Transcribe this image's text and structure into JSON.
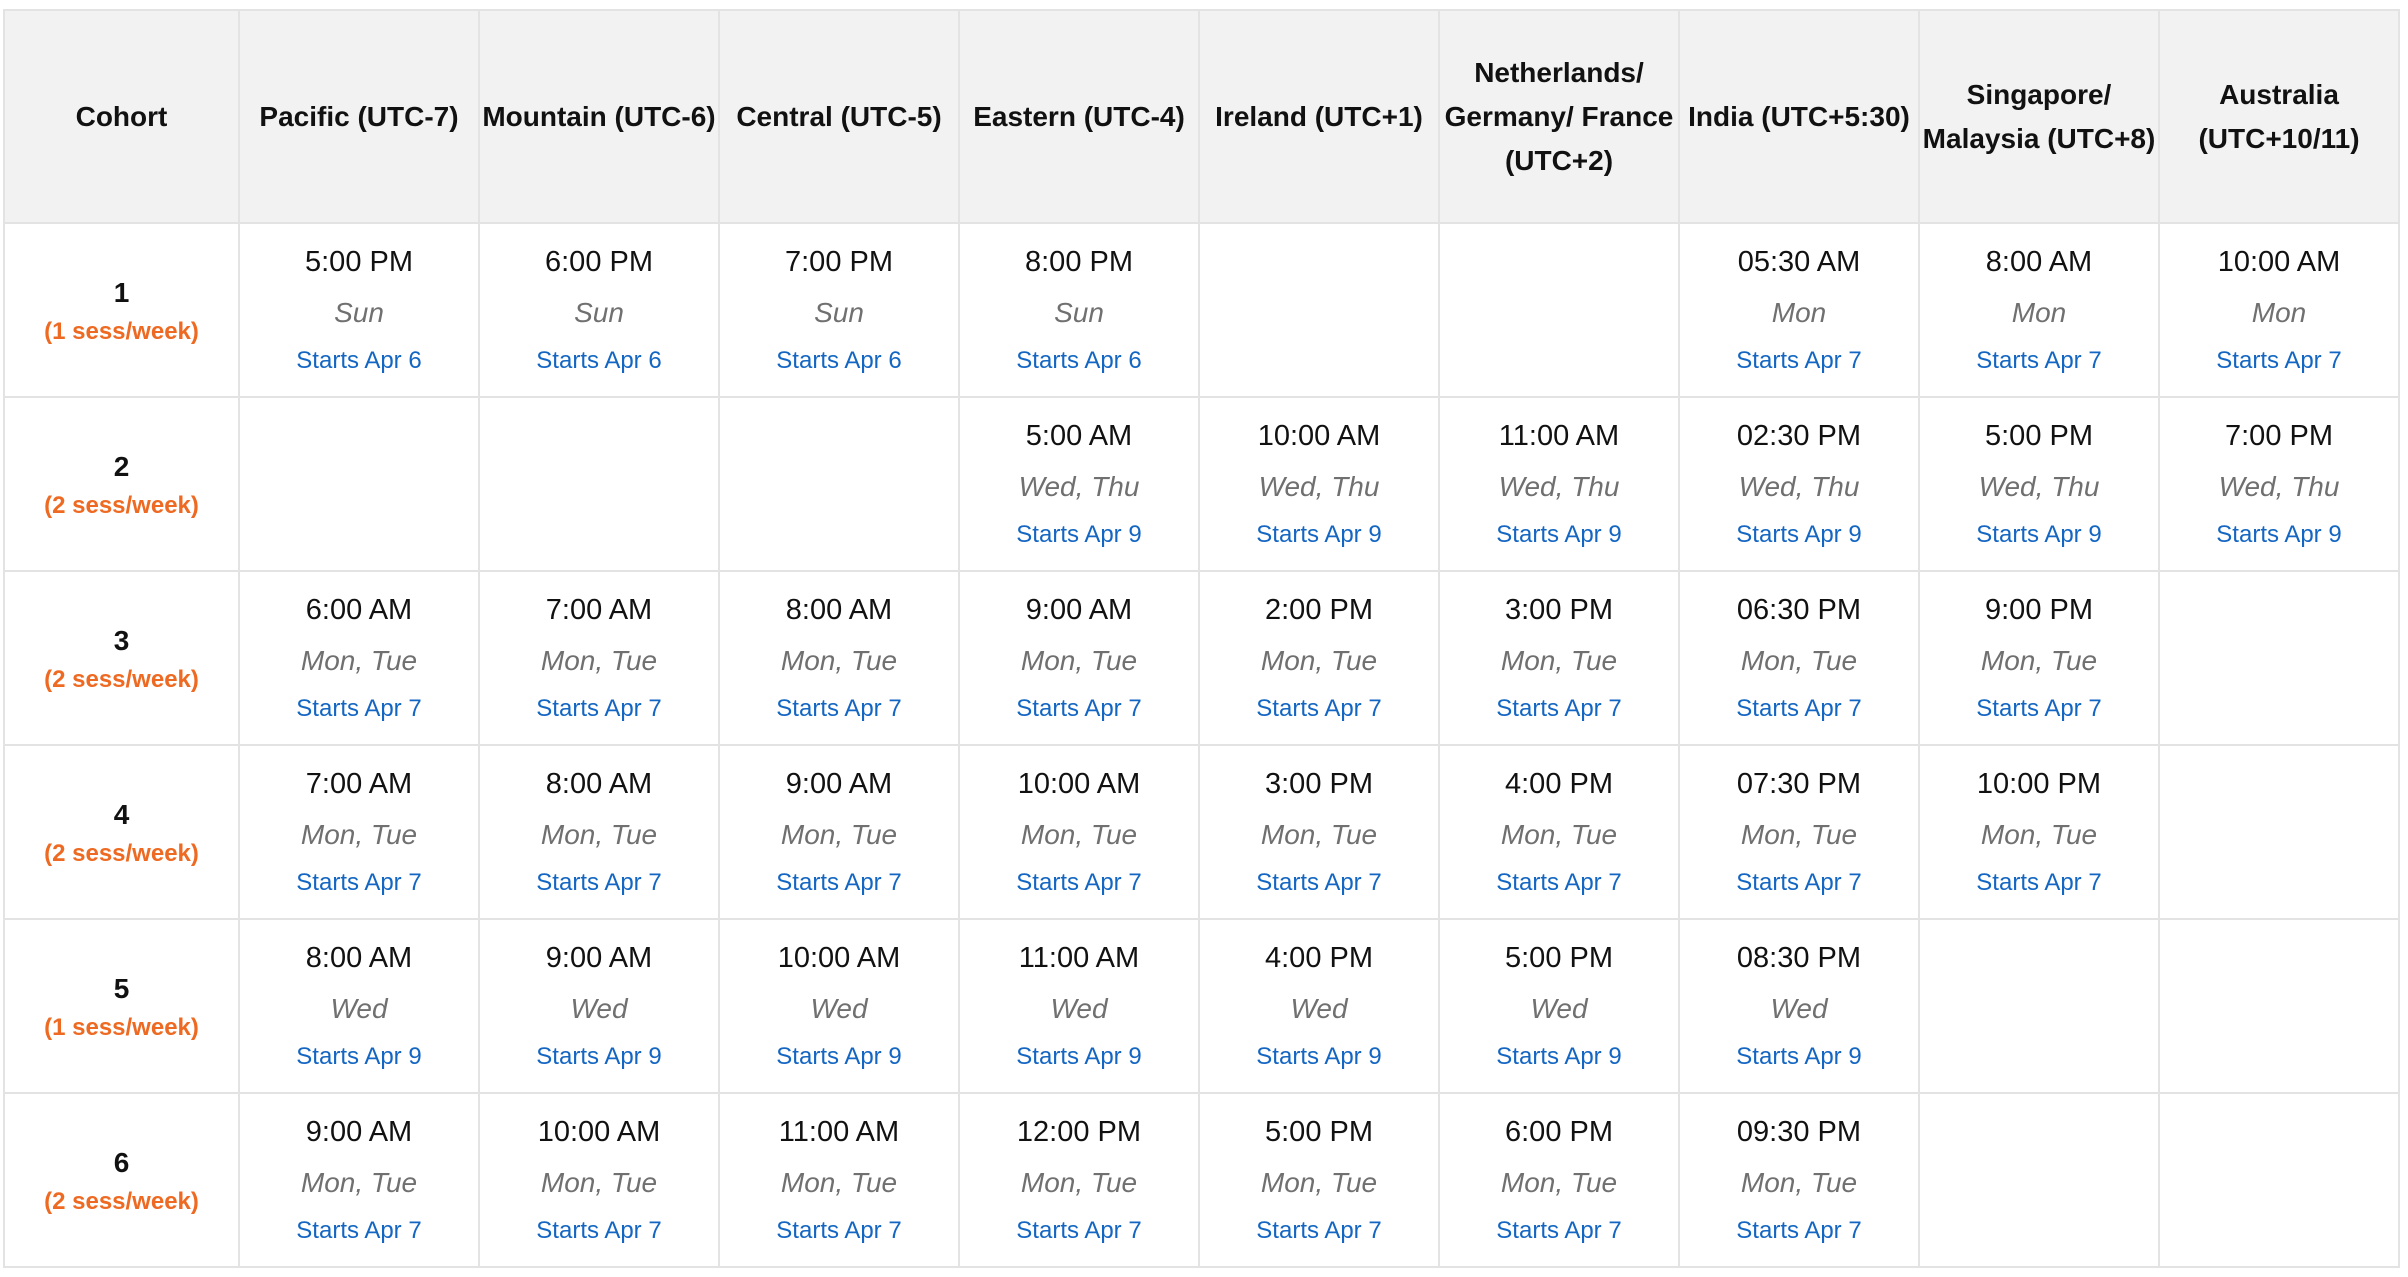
{
  "headers": [
    "Cohort",
    "Pacific (UTC-7)",
    "Mountain (UTC-6)",
    "Central (UTC-5)",
    "Eastern (UTC-4)",
    "Ireland (UTC+1)",
    "Netherlands/ Germany/ France (UTC+2)",
    "India (UTC+5:30)",
    "Singapore/ Malaysia (UTC+8)",
    "Australia (UTC+10/11)"
  ],
  "rows": [
    {
      "cohort": "1",
      "rate": "(1 sess/week)",
      "cells": [
        {
          "time": "5:00 PM",
          "days": "Sun",
          "start": "Starts Apr 6"
        },
        {
          "time": "6:00 PM",
          "days": "Sun",
          "start": "Starts Apr 6"
        },
        {
          "time": "7:00 PM",
          "days": "Sun",
          "start": "Starts Apr 6"
        },
        {
          "time": "8:00 PM",
          "days": "Sun",
          "start": "Starts Apr 6"
        },
        null,
        null,
        {
          "time": "05:30 AM",
          "days": "Mon",
          "start": "Starts Apr 7"
        },
        {
          "time": "8:00 AM",
          "days": "Mon",
          "start": "Starts Apr 7"
        },
        {
          "time": "10:00 AM",
          "days": "Mon",
          "start": "Starts Apr 7"
        }
      ]
    },
    {
      "cohort": "2",
      "rate": "(2 sess/week)",
      "cells": [
        null,
        null,
        null,
        {
          "time": "5:00 AM",
          "days": "Wed, Thu",
          "start": "Starts Apr 9"
        },
        {
          "time": "10:00 AM",
          "days": "Wed, Thu",
          "start": "Starts Apr 9"
        },
        {
          "time": "11:00 AM",
          "days": "Wed, Thu",
          "start": "Starts Apr 9"
        },
        {
          "time": "02:30 PM",
          "days": "Wed, Thu",
          "start": "Starts Apr 9"
        },
        {
          "time": "5:00 PM",
          "days": "Wed, Thu",
          "start": "Starts Apr 9"
        },
        {
          "time": "7:00 PM",
          "days": "Wed, Thu",
          "start": "Starts Apr 9"
        }
      ]
    },
    {
      "cohort": "3",
      "rate": "(2 sess/week)",
      "cells": [
        {
          "time": "6:00 AM",
          "days": "Mon, Tue",
          "start": "Starts Apr 7"
        },
        {
          "time": "7:00 AM",
          "days": "Mon, Tue",
          "start": "Starts Apr 7"
        },
        {
          "time": "8:00 AM",
          "days": "Mon, Tue",
          "start": "Starts Apr 7"
        },
        {
          "time": "9:00 AM",
          "days": "Mon, Tue",
          "start": "Starts Apr 7"
        },
        {
          "time": "2:00 PM",
          "days": "Mon, Tue",
          "start": "Starts Apr 7"
        },
        {
          "time": "3:00 PM",
          "days": "Mon, Tue",
          "start": "Starts Apr 7"
        },
        {
          "time": "06:30 PM",
          "days": "Mon, Tue",
          "start": "Starts Apr 7"
        },
        {
          "time": "9:00 PM",
          "days": "Mon, Tue",
          "start": "Starts Apr 7"
        },
        null
      ]
    },
    {
      "cohort": "4",
      "rate": "(2 sess/week)",
      "cells": [
        {
          "time": "7:00 AM",
          "days": "Mon, Tue",
          "start": "Starts Apr 7"
        },
        {
          "time": "8:00 AM",
          "days": "Mon, Tue",
          "start": "Starts Apr 7"
        },
        {
          "time": "9:00 AM",
          "days": "Mon, Tue",
          "start": "Starts Apr 7"
        },
        {
          "time": "10:00 AM",
          "days": "Mon, Tue",
          "start": "Starts Apr 7"
        },
        {
          "time": "3:00 PM",
          "days": "Mon, Tue",
          "start": "Starts Apr 7"
        },
        {
          "time": "4:00 PM",
          "days": "Mon, Tue",
          "start": "Starts Apr 7"
        },
        {
          "time": "07:30 PM",
          "days": "Mon, Tue",
          "start": "Starts Apr 7"
        },
        {
          "time": "10:00 PM",
          "days": "Mon, Tue",
          "start": "Starts Apr 7"
        },
        null
      ]
    },
    {
      "cohort": "5",
      "rate": "(1 sess/week)",
      "cells": [
        {
          "time": "8:00 AM",
          "days": "Wed",
          "start": "Starts Apr 9"
        },
        {
          "time": "9:00 AM",
          "days": "Wed",
          "start": "Starts Apr 9"
        },
        {
          "time": "10:00 AM",
          "days": "Wed",
          "start": "Starts Apr 9"
        },
        {
          "time": "11:00 AM",
          "days": "Wed",
          "start": "Starts Apr 9"
        },
        {
          "time": "4:00 PM",
          "days": "Wed",
          "start": "Starts Apr 9"
        },
        {
          "time": "5:00 PM",
          "days": "Wed",
          "start": "Starts Apr 9"
        },
        {
          "time": "08:30 PM",
          "days": "Wed",
          "start": "Starts Apr 9"
        },
        null,
        null
      ]
    },
    {
      "cohort": "6",
      "rate": "(2 sess/week)",
      "cells": [
        {
          "time": "9:00 AM",
          "days": "Mon, Tue",
          "start": "Starts Apr 7"
        },
        {
          "time": "10:00 AM",
          "days": "Mon, Tue",
          "start": "Starts Apr 7"
        },
        {
          "time": "11:00 AM",
          "days": "Mon, Tue",
          "start": "Starts Apr 7"
        },
        {
          "time": "12:00 PM",
          "days": "Mon, Tue",
          "start": "Starts Apr 7"
        },
        {
          "time": "5:00 PM",
          "days": "Mon, Tue",
          "start": "Starts Apr 7"
        },
        {
          "time": "6:00 PM",
          "days": "Mon, Tue",
          "start": "Starts Apr 7"
        },
        {
          "time": "09:30 PM",
          "days": "Mon, Tue",
          "start": "Starts Apr 7"
        },
        null,
        null
      ]
    }
  ],
  "colors": {
    "header_bg": "#f2f2f2",
    "border": "#e3e3e3",
    "cohort_rate": "#ee6a22",
    "days": "#707070",
    "start_link": "#1466c3"
  }
}
